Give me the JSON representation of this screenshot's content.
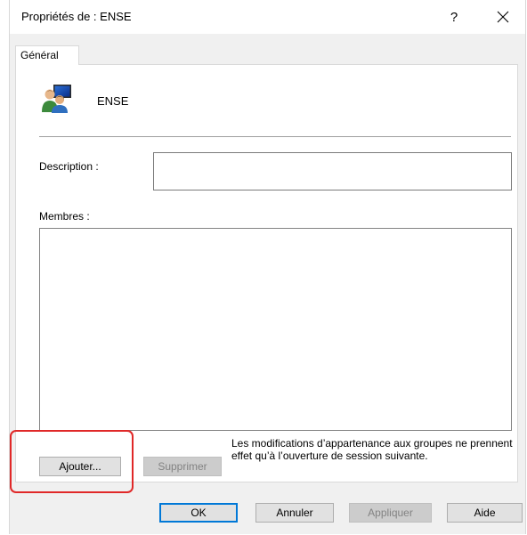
{
  "window": {
    "title": "Propriétés de : ENSE",
    "help_label": "?"
  },
  "tabs": [
    {
      "label": "Général"
    }
  ],
  "group": {
    "name": "ENSE",
    "icon": "group-users-icon"
  },
  "description": {
    "label": "Description :",
    "value": ""
  },
  "members": {
    "label": "Membres :",
    "items": []
  },
  "buttons": {
    "add": "Ajouter...",
    "remove": "Supprimer",
    "ok": "OK",
    "cancel": "Annuler",
    "apply": "Appliquer",
    "help": "Aide"
  },
  "note": "Les modifications d’appartenance aux groupes ne prennent effet qu’à l’ouverture de session suivante.",
  "colors": {
    "highlight": "#e02828",
    "default_button_border": "#0078d7",
    "dialog_background": "#f0f0f0"
  }
}
